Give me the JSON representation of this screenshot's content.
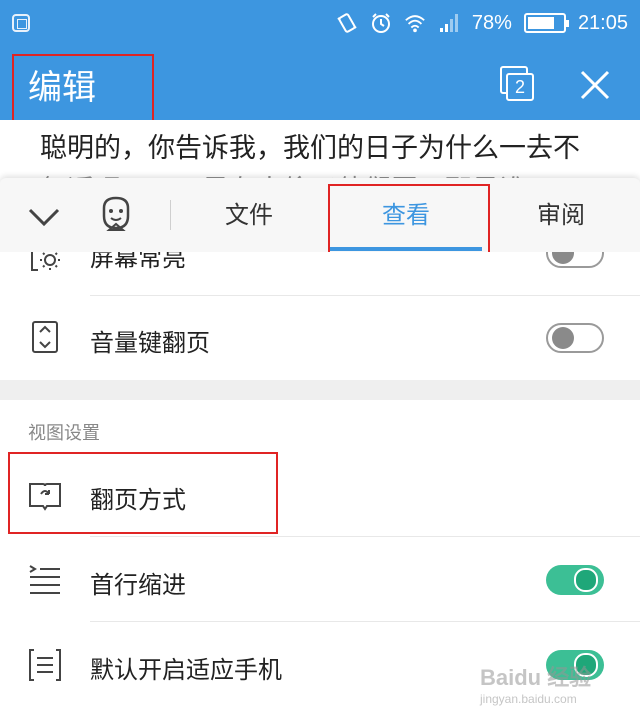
{
  "status_bar": {
    "battery_percent_text": "78%",
    "battery_level": 0.78,
    "time": "21:05",
    "icons": [
      "screenshot-icon",
      "vibrate-icon",
      "alarm-icon",
      "wifi-icon",
      "signal-icon",
      "battery-icon"
    ]
  },
  "title_bar": {
    "title": "编辑",
    "window_count": "2",
    "icons": [
      "windows-icon",
      "close-icon"
    ]
  },
  "document": {
    "line1": "聪明的，你告诉我，我们的日子为什么一去不",
    "line2": "复返呢？——是有人偷了他们罢：那是谁？"
  },
  "toolbar": {
    "icons": [
      "chevron-down-icon",
      "mascot-icon"
    ],
    "tabs": [
      "文件",
      "查看",
      "审阅"
    ],
    "active_tab": "查看"
  },
  "settings": {
    "items": [
      {
        "label": "屏幕常亮",
        "toggle": "off",
        "icon": "brightness-icon"
      },
      {
        "label": "音量键翻页",
        "toggle": "off",
        "icon": "volume-page-icon"
      }
    ],
    "view_section_title": "视图设置",
    "view_items": [
      {
        "label": "翻页方式",
        "icon": "book-flip-icon"
      },
      {
        "label": "首行缩进",
        "toggle": "on",
        "icon": "indent-icon"
      },
      {
        "label": "默认开启适应手机",
        "toggle": "on",
        "icon": "fit-phone-icon"
      }
    ]
  },
  "watermark": {
    "text": "Baidu 经验",
    "url": "jingyan.baidu.com"
  },
  "colors": {
    "accent": "#3d96e0",
    "toggle_on": "#3cbf95",
    "highlight_box": "#e02424"
  }
}
